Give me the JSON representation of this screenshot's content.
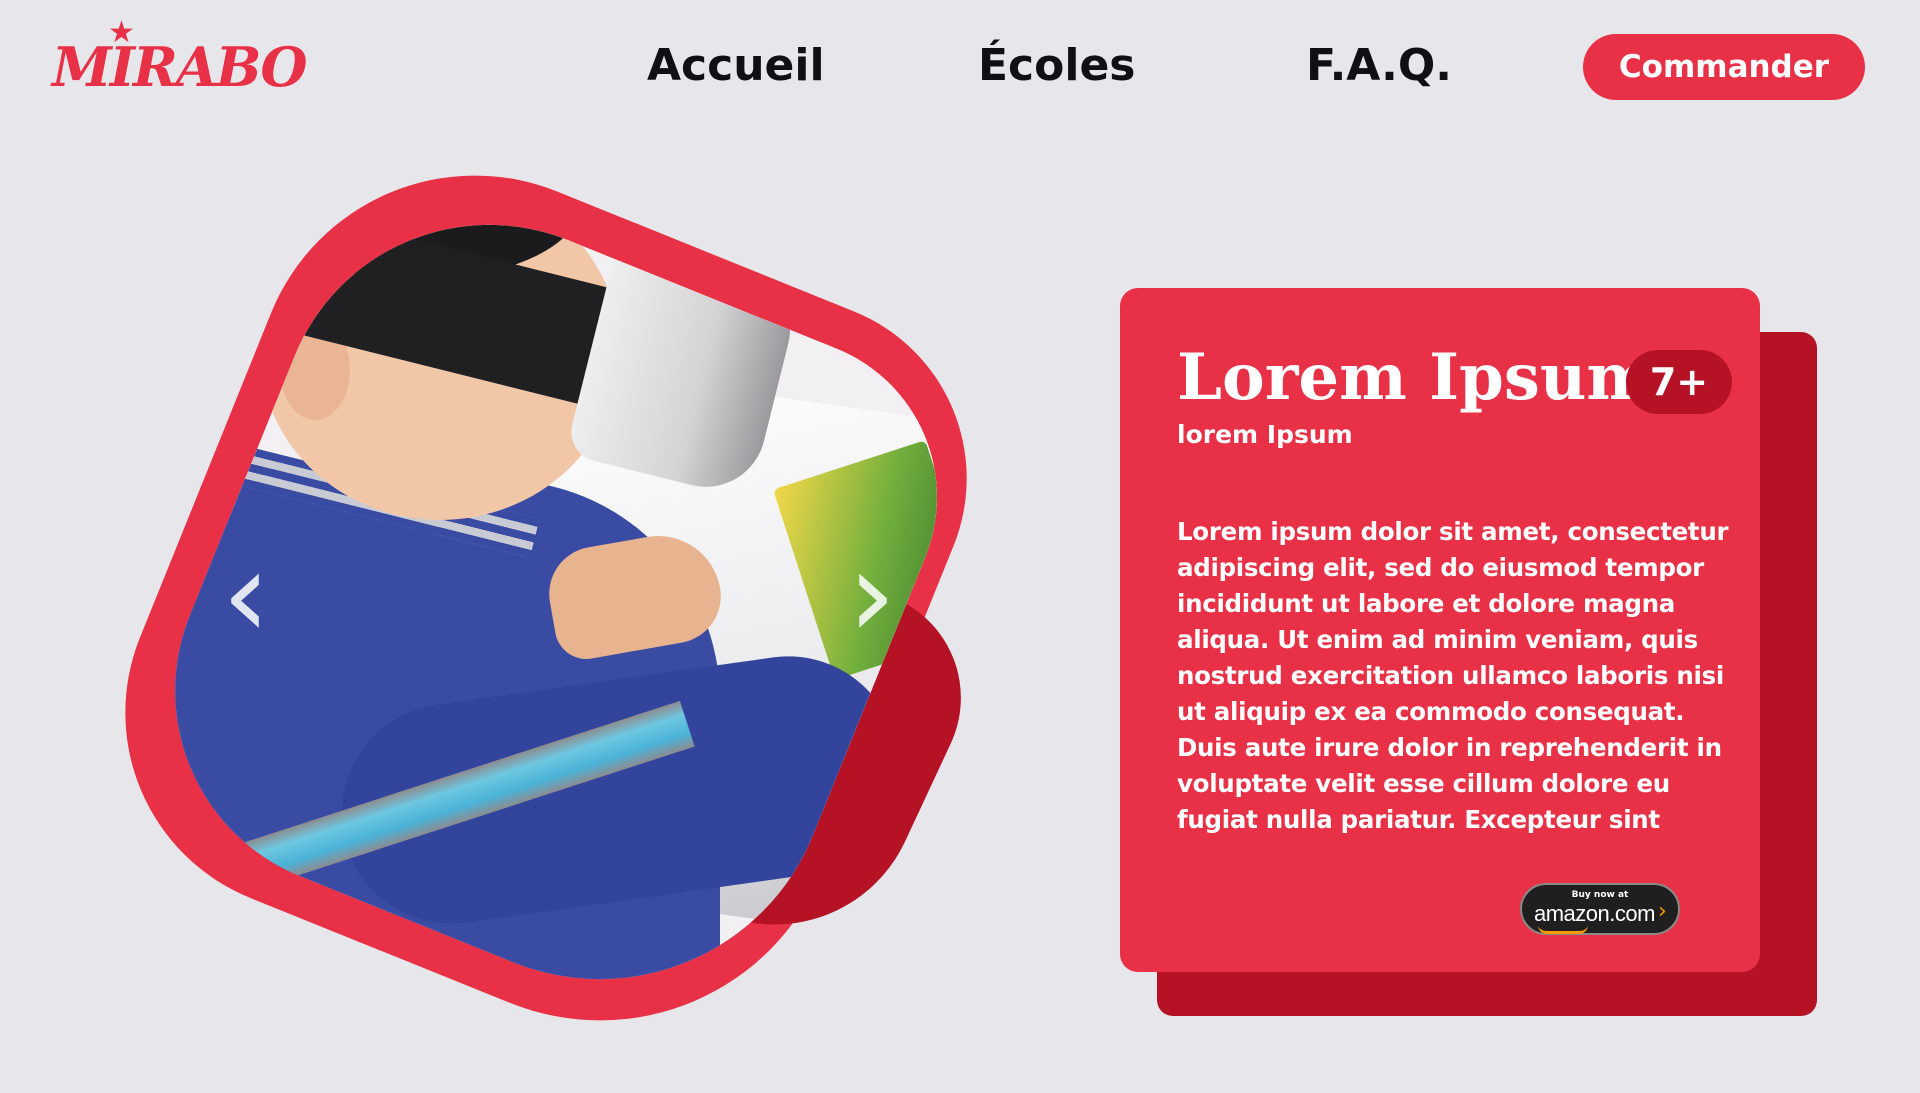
{
  "brand": {
    "logo_text": "MIRABO",
    "logo_star": "★"
  },
  "nav": {
    "items": [
      {
        "label": "Accueil"
      },
      {
        "label": "Écoles"
      },
      {
        "label": "F.A.Q."
      }
    ],
    "cta_label": "Commander"
  },
  "hero": {
    "image_alt": "Child wearing a VR headset",
    "prev_arrow": "‹",
    "next_arrow": "›"
  },
  "card": {
    "title": "Lorem Ipsum",
    "subtitle": "lorem Ipsum",
    "age_badge": "7+",
    "body": "Lorem ipsum dolor sit amet, consectetur adipiscing elit, sed do eiusmod tempor incididunt ut labore et dolore magna aliqua. Ut enim ad minim veniam, quis nostrud exercitation ullamco laboris nisi ut aliquip ex ea commodo consequat. Duis aute irure dolor in reprehenderit in voluptate velit esse cillum dolore eu fugiat nulla pariatur. Excepteur sint",
    "amazon": {
      "top": "Buy now at",
      "main": "amazon.com",
      "chevron": "›"
    }
  },
  "colors": {
    "accent": "#e83146",
    "accent_dark": "#b51226",
    "background": "#e7e7eb",
    "nav_text": "#0f0f14"
  }
}
